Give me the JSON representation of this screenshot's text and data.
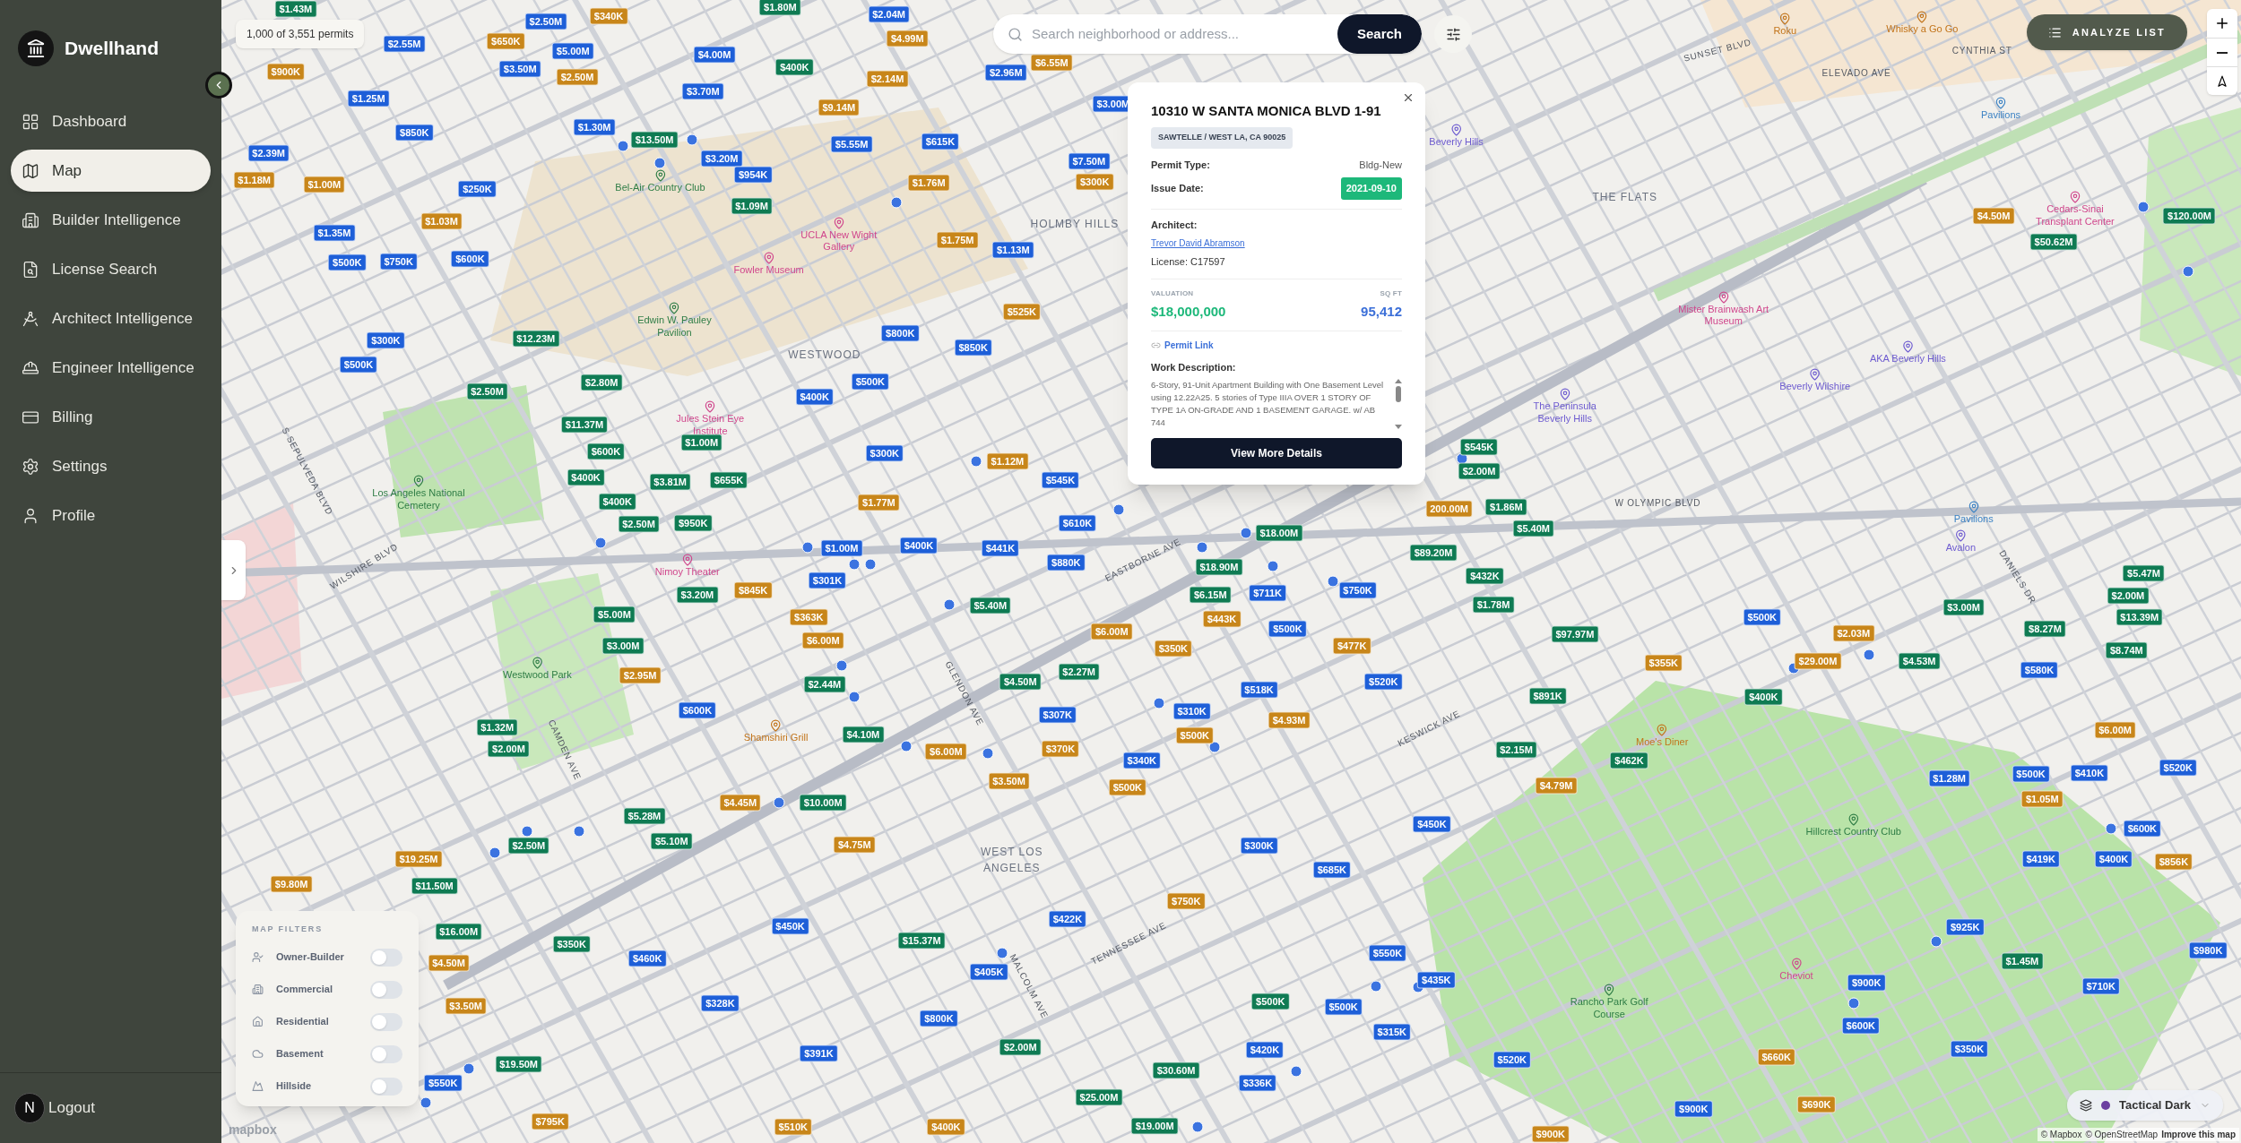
{
  "app": {
    "name": "Dwellhand"
  },
  "sidebar": {
    "items": [
      {
        "label": "Dashboard",
        "selected": false
      },
      {
        "label": "Map",
        "selected": true
      },
      {
        "label": "Builder Intelligence",
        "selected": false
      },
      {
        "label": "License Search",
        "selected": false
      },
      {
        "label": "Architect Intelligence",
        "selected": false
      },
      {
        "label": "Engineer Intelligence",
        "selected": false
      },
      {
        "label": "Billing",
        "selected": false
      },
      {
        "label": "Settings",
        "selected": false
      },
      {
        "label": "Profile",
        "selected": false
      }
    ],
    "logout": {
      "avatar": "N",
      "label": "Logout"
    }
  },
  "map": {
    "permit_count": "1,000 of 3,551 permits",
    "search": {
      "placeholder": "Search neighborhood or address...",
      "button": "Search"
    },
    "analyze_button": "ANALYZE LIST",
    "style_picker": {
      "label": "Tactical Dark"
    },
    "attribution": {
      "mapbox": "© Mapbox",
      "osm": "© OpenStreetMap",
      "improve": "Improve this map"
    },
    "logo": "mapbox",
    "streets": [
      "SUNSET BLVD",
      "CYNTHIA ST",
      "ELEVADO AVE",
      "S SEPULVEDA BLVD",
      "W OLYMPIC BLVD",
      "EASTBORNE AVE",
      "WILSHIRE BLVD",
      "DANIELS DR",
      "GLENDON AVE",
      "KESWICK AVE",
      "CAMDEN AVE",
      "TENNESSEE AVE",
      "MALCOLM AVE"
    ],
    "places": [
      {
        "label": "Roku",
        "kind": "food"
      },
      {
        "label": "Whisky a Go Go",
        "kind": "food"
      },
      {
        "label": "Pavilions",
        "kind": "shop"
      },
      {
        "label": "Beverly Hills",
        "kind": "hotel"
      },
      {
        "label": "Bel-Air Country Club",
        "kind": "park"
      },
      {
        "label": "THE FLATS",
        "kind": "area"
      },
      {
        "label": "Cedars-Sinai Transplant Center",
        "kind": "culture"
      },
      {
        "label": "UCLA New Wight Gallery",
        "kind": "culture"
      },
      {
        "label": "HOLMBY HILLS",
        "kind": "area"
      },
      {
        "label": "Fowler Museum",
        "kind": "culture"
      },
      {
        "label": "Mister Brainwash Art Museum",
        "kind": "culture"
      },
      {
        "label": "Edwin W. Pauley Pavilion",
        "kind": "park"
      },
      {
        "label": "WESTWOOD",
        "kind": "area"
      },
      {
        "label": "AKA Beverly Hills",
        "kind": "hotel"
      },
      {
        "label": "Beverly Wilshire",
        "kind": "hotel"
      },
      {
        "label": "The Peninsula Beverly Hills",
        "kind": "hotel"
      },
      {
        "label": "Jules Stein Eye Institute",
        "kind": "culture"
      },
      {
        "label": "Los Angeles National Cemetery",
        "kind": "park"
      },
      {
        "label": "Pavilions",
        "kind": "shop"
      },
      {
        "label": "Avalon",
        "kind": "hotel"
      },
      {
        "label": "Nimoy Theater",
        "kind": "culture"
      },
      {
        "label": "Westwood Park",
        "kind": "park"
      },
      {
        "label": "Shamshiri Grill",
        "kind": "food"
      },
      {
        "label": "Moe's Diner",
        "kind": "food"
      },
      {
        "label": "Hillcrest Country Club",
        "kind": "park"
      },
      {
        "label": "WEST LOS ANGELES",
        "kind": "area"
      },
      {
        "label": "Cheviot",
        "kind": "culture"
      },
      {
        "label": "Rancho Park Golf Course",
        "kind": "park"
      }
    ],
    "pins": [
      {
        "label": "$1.43M",
        "color": "#0f7b53"
      },
      {
        "label": "$2.50M",
        "color": "#1e5fd8"
      },
      {
        "label": "$340K",
        "color": "#c8861a"
      },
      {
        "label": "$1.80M",
        "color": "#0f7b53"
      },
      {
        "label": "$2.04M",
        "color": "#1e5fd8"
      },
      {
        "label": "$2.55M",
        "color": "#1e5fd8"
      },
      {
        "label": "$650K",
        "color": "#c8861a"
      },
      {
        "label": "$5.00M",
        "color": "#1e5fd8"
      },
      {
        "label": "$4.00M",
        "color": "#1e5fd8"
      },
      {
        "label": "$4.99M",
        "color": "#c8861a"
      },
      {
        "label": "$900K",
        "color": "#c8861a"
      },
      {
        "label": "$3.50M",
        "color": "#1e5fd8"
      },
      {
        "label": "$2.50M",
        "color": "#c8861a"
      },
      {
        "label": "$400K",
        "color": "#0f7b53"
      },
      {
        "label": "$2.14M",
        "color": "#c8861a"
      },
      {
        "label": "$2.96M",
        "color": "#1e5fd8"
      },
      {
        "label": "$6.55M",
        "color": "#c8861a"
      },
      {
        "label": "$1.25M",
        "color": "#1e5fd8"
      },
      {
        "label": "$3.70M",
        "color": "#1e5fd8"
      },
      {
        "label": "$9.14M",
        "color": "#c8861a"
      },
      {
        "label": "$3.00M",
        "color": "#1e5fd8"
      },
      {
        "label": "$850K",
        "color": "#1e5fd8"
      },
      {
        "label": "$1.30M",
        "color": "#1e5fd8"
      },
      {
        "label": "$13.50M",
        "color": "#0f7b53"
      },
      {
        "label": "$5.55M",
        "color": "#1e5fd8"
      },
      {
        "label": "$615K",
        "color": "#1e5fd8"
      },
      {
        "label": "$2.39M",
        "color": "#1e5fd8"
      },
      {
        "label": "$3.20M",
        "color": "#1e5fd8"
      },
      {
        "label": "$7.50M",
        "color": "#1e5fd8"
      },
      {
        "label": "$1.18M",
        "color": "#c8861a"
      },
      {
        "label": "$1.00M",
        "color": "#c8861a"
      },
      {
        "label": "$250K",
        "color": "#1e5fd8"
      },
      {
        "label": "$954K",
        "color": "#1e5fd8"
      },
      {
        "label": "$1.76M",
        "color": "#c8861a"
      },
      {
        "label": "$300K",
        "color": "#c8861a"
      },
      {
        "label": "$1.09M",
        "color": "#0f7b53"
      },
      {
        "label": "$1.03M",
        "color": "#c8861a"
      },
      {
        "label": "$4.50M",
        "color": "#c8861a"
      },
      {
        "label": "$120.00M",
        "color": "#0f7b53"
      },
      {
        "label": "$1.35M",
        "color": "#1e5fd8"
      },
      {
        "label": "$1.75M",
        "color": "#c8861a"
      },
      {
        "label": "$50.62M",
        "color": "#0f7b53"
      },
      {
        "label": "$1.13M",
        "color": "#1e5fd8"
      },
      {
        "label": "$500K",
        "color": "#1e5fd8"
      },
      {
        "label": "$750K",
        "color": "#1e5fd8"
      },
      {
        "label": "$600K",
        "color": "#1e5fd8"
      },
      {
        "label": "$525K",
        "color": "#c8861a"
      },
      {
        "label": "$800K",
        "color": "#1e5fd8"
      },
      {
        "label": "$300K",
        "color": "#1e5fd8"
      },
      {
        "label": "$12.23M",
        "color": "#0f7b53"
      },
      {
        "label": "$850K",
        "color": "#1e5fd8"
      },
      {
        "label": "$500K",
        "color": "#1e5fd8"
      },
      {
        "label": "$2.80M",
        "color": "#0f7b53"
      },
      {
        "label": "$500K",
        "color": "#1e5fd8"
      },
      {
        "label": "$2.50M",
        "color": "#0f7b53"
      },
      {
        "label": "$400K",
        "color": "#1e5fd8"
      },
      {
        "label": "$11.37M",
        "color": "#0f7b53"
      },
      {
        "label": "$600K",
        "color": "#0f7b53"
      },
      {
        "label": "$1.00M",
        "color": "#0f7b53"
      },
      {
        "label": "$300K",
        "color": "#1e5fd8"
      },
      {
        "label": "$545K",
        "color": "#0f7b53"
      },
      {
        "label": "$1.12M",
        "color": "#c8861a"
      },
      {
        "label": "$400K",
        "color": "#0f7b53"
      },
      {
        "label": "$3.81M",
        "color": "#0f7b53"
      },
      {
        "label": "$655K",
        "color": "#0f7b53"
      },
      {
        "label": "$545K",
        "color": "#1e5fd8"
      },
      {
        "label": "$2.00M",
        "color": "#0f7b53"
      },
      {
        "label": "$400K",
        "color": "#0f7b53"
      },
      {
        "label": "$1.77M",
        "color": "#c8861a"
      },
      {
        "label": "200.00M",
        "color": "#c8861a"
      },
      {
        "label": "$1.86M",
        "color": "#0f7b53"
      },
      {
        "label": "$2.50M",
        "color": "#0f7b53"
      },
      {
        "label": "$950K",
        "color": "#0f7b53"
      },
      {
        "label": "$610K",
        "color": "#1e5fd8"
      },
      {
        "label": "$18.00M",
        "color": "#0f7b53"
      },
      {
        "label": "$5.40M",
        "color": "#0f7b53"
      },
      {
        "label": "$1.00M",
        "color": "#1e5fd8"
      },
      {
        "label": "$400K",
        "color": "#1e5fd8"
      },
      {
        "label": "$441K",
        "color": "#1e5fd8"
      },
      {
        "label": "$89.20M",
        "color": "#0f7b53"
      },
      {
        "label": "$301K",
        "color": "#1e5fd8"
      },
      {
        "label": "$880K",
        "color": "#1e5fd8"
      },
      {
        "label": "$18.90M",
        "color": "#0f7b53"
      },
      {
        "label": "$432K",
        "color": "#0f7b53"
      },
      {
        "label": "$5.47M",
        "color": "#0f7b53"
      },
      {
        "label": "$3.20M",
        "color": "#0f7b53"
      },
      {
        "label": "$845K",
        "color": "#c8861a"
      },
      {
        "label": "$6.15M",
        "color": "#0f7b53"
      },
      {
        "label": "$711K",
        "color": "#1e5fd8"
      },
      {
        "label": "$750K",
        "color": "#1e5fd8"
      },
      {
        "label": "$2.00M",
        "color": "#0f7b53"
      },
      {
        "label": "$5.00M",
        "color": "#0f7b53"
      },
      {
        "label": "$363K",
        "color": "#c8861a"
      },
      {
        "label": "$5.40M",
        "color": "#0f7b53"
      },
      {
        "label": "$443K",
        "color": "#c8861a"
      },
      {
        "label": "$1.78M",
        "color": "#0f7b53"
      },
      {
        "label": "$500K",
        "color": "#1e5fd8"
      },
      {
        "label": "$3.00M",
        "color": "#0f7b53"
      },
      {
        "label": "$13.39M",
        "color": "#0f7b53"
      },
      {
        "label": "$3.00M",
        "color": "#0f7b53"
      },
      {
        "label": "$6.00M",
        "color": "#c8861a"
      },
      {
        "label": "$6.00M",
        "color": "#c8861a"
      },
      {
        "label": "$350K",
        "color": "#c8861a"
      },
      {
        "label": "$500K",
        "color": "#1e5fd8"
      },
      {
        "label": "$477K",
        "color": "#c8861a"
      },
      {
        "label": "$97.97M",
        "color": "#0f7b53"
      },
      {
        "label": "$2.03M",
        "color": "#c8861a"
      },
      {
        "label": "$8.27M",
        "color": "#0f7b53"
      },
      {
        "label": "$8.74M",
        "color": "#0f7b53"
      },
      {
        "label": "$2.95M",
        "color": "#c8861a"
      },
      {
        "label": "$2.44M",
        "color": "#0f7b53"
      },
      {
        "label": "$4.50M",
        "color": "#0f7b53"
      },
      {
        "label": "$2.27M",
        "color": "#0f7b53"
      },
      {
        "label": "$518K",
        "color": "#1e5fd8"
      },
      {
        "label": "$520K",
        "color": "#1e5fd8"
      },
      {
        "label": "$891K",
        "color": "#0f7b53"
      },
      {
        "label": "$355K",
        "color": "#c8861a"
      },
      {
        "label": "$400K",
        "color": "#0f7b53"
      },
      {
        "label": "$29.00M",
        "color": "#c8861a"
      },
      {
        "label": "$4.53M",
        "color": "#0f7b53"
      },
      {
        "label": "$580K",
        "color": "#1e5fd8"
      },
      {
        "label": "$1.32M",
        "color": "#0f7b53"
      },
      {
        "label": "$600K",
        "color": "#1e5fd8"
      },
      {
        "label": "$4.10M",
        "color": "#0f7b53"
      },
      {
        "label": "$307K",
        "color": "#1e5fd8"
      },
      {
        "label": "$310K",
        "color": "#1e5fd8"
      },
      {
        "label": "$500K",
        "color": "#c8861a"
      },
      {
        "label": "$4.93M",
        "color": "#c8861a"
      },
      {
        "label": "$6.00M",
        "color": "#c8861a"
      },
      {
        "label": "$2.00M",
        "color": "#0f7b53"
      },
      {
        "label": "$6.00M",
        "color": "#c8861a"
      },
      {
        "label": "$370K",
        "color": "#c8861a"
      },
      {
        "label": "$2.15M",
        "color": "#0f7b53"
      },
      {
        "label": "$3.50M",
        "color": "#c8861a"
      },
      {
        "label": "$500K",
        "color": "#c8861a"
      },
      {
        "label": "$340K",
        "color": "#1e5fd8"
      },
      {
        "label": "$4.79M",
        "color": "#c8861a"
      },
      {
        "label": "$462K",
        "color": "#0f7b53"
      },
      {
        "label": "$1.28M",
        "color": "#1e5fd8"
      },
      {
        "label": "$500K",
        "color": "#1e5fd8"
      },
      {
        "label": "$410K",
        "color": "#1e5fd8"
      },
      {
        "label": "$520K",
        "color": "#1e5fd8"
      },
      {
        "label": "$4.45M",
        "color": "#c8861a"
      },
      {
        "label": "$10.00M",
        "color": "#0f7b53"
      },
      {
        "label": "$1.05M",
        "color": "#c8861a"
      },
      {
        "label": "$5.28M",
        "color": "#0f7b53"
      },
      {
        "label": "$450K",
        "color": "#1e5fd8"
      },
      {
        "label": "$600K",
        "color": "#1e5fd8"
      },
      {
        "label": "$2.50M",
        "color": "#0f7b53"
      },
      {
        "label": "$5.10M",
        "color": "#0f7b53"
      },
      {
        "label": "$4.75M",
        "color": "#c8861a"
      },
      {
        "label": "$300K",
        "color": "#1e5fd8"
      },
      {
        "label": "$19.25M",
        "color": "#c8861a"
      },
      {
        "label": "$419K",
        "color": "#1e5fd8"
      },
      {
        "label": "$400K",
        "color": "#1e5fd8"
      },
      {
        "label": "$856K",
        "color": "#c8861a"
      },
      {
        "label": "$685K",
        "color": "#1e5fd8"
      },
      {
        "label": "$9.80M",
        "color": "#c8861a"
      },
      {
        "label": "$11.50M",
        "color": "#0f7b53"
      },
      {
        "label": "$750K",
        "color": "#c8861a"
      },
      {
        "label": "$16.00M",
        "color": "#0f7b53"
      },
      {
        "label": "$450K",
        "color": "#1e5fd8"
      },
      {
        "label": "$422K",
        "color": "#1e5fd8"
      },
      {
        "label": "$925K",
        "color": "#1e5fd8"
      },
      {
        "label": "$4.50M",
        "color": "#c8861a"
      },
      {
        "label": "$350K",
        "color": "#0f7b53"
      },
      {
        "label": "$460K",
        "color": "#1e5fd8"
      },
      {
        "label": "$15.37M",
        "color": "#0f7b53"
      },
      {
        "label": "$550K",
        "color": "#1e5fd8"
      },
      {
        "label": "$1.45M",
        "color": "#0f7b53"
      },
      {
        "label": "$980K",
        "color": "#1e5fd8"
      },
      {
        "label": "$405K",
        "color": "#1e5fd8"
      },
      {
        "label": "$435K",
        "color": "#1e5fd8"
      },
      {
        "label": "$900K",
        "color": "#1e5fd8"
      },
      {
        "label": "$710K",
        "color": "#1e5fd8"
      },
      {
        "label": "$3.50M",
        "color": "#c8861a"
      },
      {
        "label": "$328K",
        "color": "#1e5fd8"
      },
      {
        "label": "$500K",
        "color": "#0f7b53"
      },
      {
        "label": "$500K",
        "color": "#1e5fd8"
      },
      {
        "label": "$800K",
        "color": "#1e5fd8"
      },
      {
        "label": "$315K",
        "color": "#1e5fd8"
      },
      {
        "label": "$600K",
        "color": "#1e5fd8"
      },
      {
        "label": "$19.50M",
        "color": "#0f7b53"
      },
      {
        "label": "$391K",
        "color": "#1e5fd8"
      },
      {
        "label": "$2.00M",
        "color": "#0f7b53"
      },
      {
        "label": "$30.60M",
        "color": "#0f7b53"
      },
      {
        "label": "$420K",
        "color": "#1e5fd8"
      },
      {
        "label": "$520K",
        "color": "#1e5fd8"
      },
      {
        "label": "$660K",
        "color": "#c8861a"
      },
      {
        "label": "$350K",
        "color": "#1e5fd8"
      },
      {
        "label": "$550K",
        "color": "#1e5fd8"
      },
      {
        "label": "$336K",
        "color": "#1e5fd8"
      },
      {
        "label": "$25.00M",
        "color": "#0f7b53"
      },
      {
        "label": "$900K",
        "color": "#1e5fd8"
      },
      {
        "label": "$690K",
        "color": "#c8861a"
      },
      {
        "label": "$795K",
        "color": "#c8861a"
      },
      {
        "label": "$510K",
        "color": "#c8861a"
      },
      {
        "label": "$400K",
        "color": "#c8861a"
      },
      {
        "label": "$19.00M",
        "color": "#0f7b53"
      },
      {
        "label": "$900K",
        "color": "#c8861a"
      }
    ]
  },
  "popup": {
    "title": "10310 W SANTA MONICA BLVD 1-91",
    "location": "SAWTELLE / WEST LA, CA 90025",
    "rows": [
      {
        "label": "Permit Type:",
        "value": "Bldg-New",
        "kind": "text"
      },
      {
        "label": "Issue Date:",
        "value": "2021-09-10",
        "kind": "badge"
      }
    ],
    "architect_label": "Architect:",
    "architect_name": "Trevor David Abramson",
    "license": "License: C17597",
    "valuation_label": "VALUATION",
    "valuation": "$18,000,000",
    "sqft_label": "SQ FT",
    "sqft": "95,412",
    "permit_link": "Permit Link",
    "description_label": "Work Description:",
    "description": "6-Story, 91-Unit Apartment Building with One Basement Level using 12.22A25. 5 stories of Type IIIA OVER 1 STORY OF TYPE 1A ON-GRADE AND 1 BASEMENT GARAGE. w/ AB 744",
    "button": "View More Details"
  },
  "filters": {
    "title": "MAP FILTERS",
    "items": [
      {
        "label": "Owner-Builder",
        "on": false
      },
      {
        "label": "Commercial",
        "on": false
      },
      {
        "label": "Residential",
        "on": false
      },
      {
        "label": "Basement",
        "on": false
      },
      {
        "label": "Hillside",
        "on": false
      }
    ]
  }
}
